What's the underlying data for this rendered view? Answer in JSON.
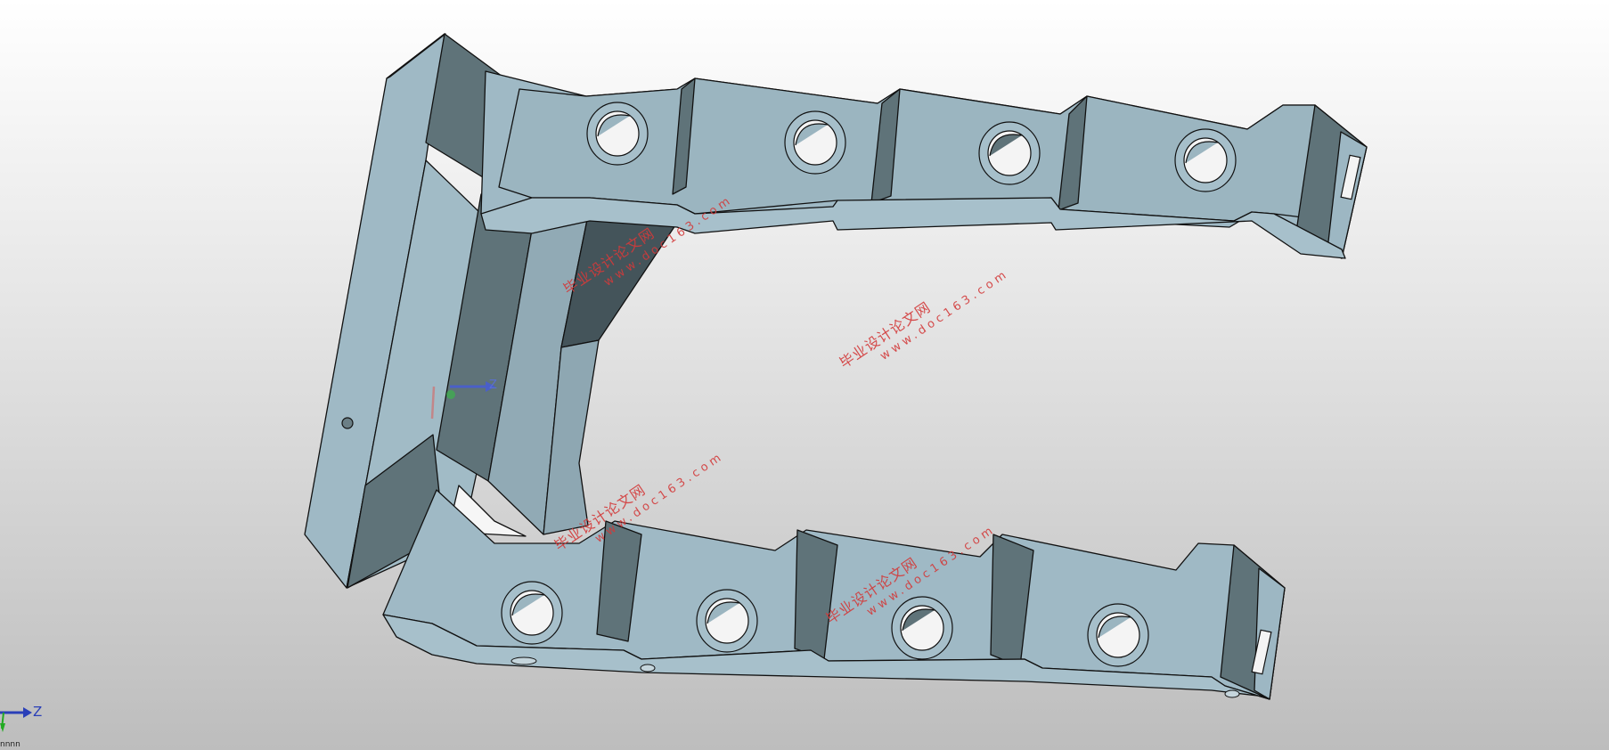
{
  "viewport": {
    "background_top": "#ffffff",
    "background_bottom": "#bdbdbd"
  },
  "model": {
    "face_light": "#9db7c3",
    "face_mid": "#8ea6b1",
    "face_dark": "#5f7379",
    "edge_color": "#111111",
    "hole_light": "#f5f5f5"
  },
  "watermarks": [
    {
      "cn": "毕业设计论文网",
      "url": "www.doc163.com"
    },
    {
      "cn": "毕业设计论文网",
      "url": "www.doc163.com"
    },
    {
      "cn": "毕业设计论文网",
      "url": "www.doc163.com"
    },
    {
      "cn": "毕业设计论文网",
      "url": "www.doc163.com"
    }
  ],
  "origin_marker": {
    "axis_label": "Z"
  },
  "triad": {
    "z_label": "Z",
    "sub_text": "nnnn"
  },
  "colors": {
    "watermark": "#d33a3a",
    "axis_z": "#2a3fb8",
    "axis_y": "#22aa22",
    "axis_x": "#cc3333"
  }
}
